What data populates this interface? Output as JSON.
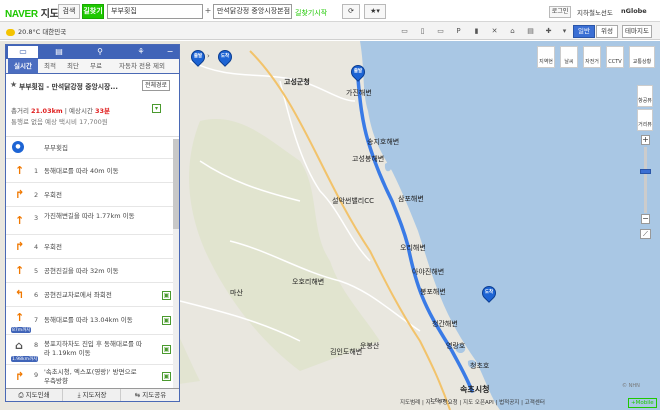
{
  "header": {
    "logo_brand": "NAVER",
    "logo_product": "지도",
    "search_tab": "검색",
    "directions_tab": "길찾기",
    "origin": "부부횟집",
    "destination": "만석닭강정 중앙시장본점",
    "find_start": "길찾기시작",
    "login": "로그인",
    "subway": "지하철노선도",
    "nglobe": "nGlobe"
  },
  "toolbar": {
    "weather": "20.8°C 대한민국",
    "view_normal": "일반",
    "view_satellite": "위성",
    "view_theme": "테마지도"
  },
  "panel": {
    "tabs": [
      "실시간",
      "최적",
      "최단",
      "무료",
      "자동차 전용 제외"
    ],
    "route_title": "부부횟집 - 만석닭강정 중앙시장...",
    "all_routes": "전체경로",
    "summary_prefix": "총거리",
    "distance": "21.03km",
    "time_prefix": "예상시간",
    "time": "33분",
    "taxi": "통행료 없음 예상 택시비 17,700원",
    "steps": [
      {
        "num": "",
        "text": "부부횟집",
        "icon": "start-flag"
      },
      {
        "num": "1",
        "text": "동해대로를 따라 40m 이동",
        "icon": "straight-arrow"
      },
      {
        "num": "2",
        "text": "우회전",
        "icon": "right-arrow"
      },
      {
        "num": "3",
        "text": "가진해변길을 따라 1.77km 이동",
        "icon": "straight-arrow"
      },
      {
        "num": "4",
        "text": "우회전",
        "icon": "right-arrow"
      },
      {
        "num": "5",
        "text": "공현진길을 따라 32m 이동",
        "icon": "straight-arrow"
      },
      {
        "num": "6",
        "text": "공현진교차로에서 좌회전",
        "icon": "left-arrow"
      },
      {
        "num": "7",
        "text": "동해대로를 따라 13.04km 이동",
        "icon": "straight-arrow"
      },
      {
        "num": "8",
        "text": "봉포지하차도 진입 후 동해대로를 따라 1.19km 이동",
        "icon": "tunnel"
      },
      {
        "num": "9",
        "text": "'속초시청, 엑스포(영랑)' 방면으로 우측방향",
        "icon": "right-arrow"
      }
    ],
    "badges": [
      "87m까지",
      "1.98km까지"
    ],
    "footer": [
      "지도인쇄",
      "지도저장",
      "지도공유"
    ]
  },
  "map": {
    "labels": [
      "고성군청",
      "가진해변",
      "송지호해변",
      "고성봉해변",
      "속초시청",
      "설악썬밸리CC",
      "삼포해변",
      "아야진해변",
      "오호리해변",
      "봉포해변",
      "청간해변",
      "청초호",
      "영랑호",
      "마산",
      "운봉산",
      "김인도해변",
      "오리해변"
    ],
    "pin_start": "출발",
    "pin_end": "도착",
    "right_tools": [
      "지역현황도",
      "날씨",
      "자전거",
      "CCTV",
      "교통상황"
    ],
    "zoom_tools": [
      "항공뷰",
      "거리뷰"
    ],
    "footer": "지도범례 | 지도 수정요청 | 지도 오픈API | 법적공지 | 고객센터",
    "copyright": "© NHN",
    "mobile": "Mobile",
    "scale": "1.6km"
  },
  "colors": {
    "naver_green": "#1ec800",
    "panel_blue": "#4064b8",
    "route_blue": "#1d64d4",
    "sea": "#a9c7e4",
    "land": "#e9e7df"
  }
}
